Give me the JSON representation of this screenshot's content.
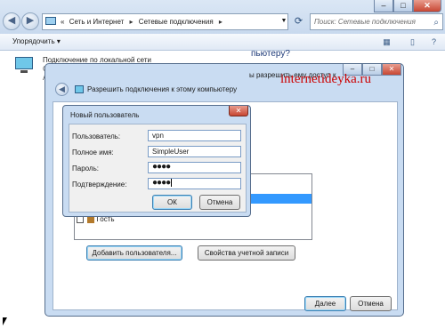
{
  "explorer": {
    "breadcrumb_lead": "«",
    "breadcrumbs": [
      "Сеть и Интернет",
      "Сетевые подключения"
    ],
    "separator": "▸",
    "search_placeholder": "Поиск: Сетевые подключения",
    "window_controls": {
      "minimize": "–",
      "maximize": "□",
      "close": "✕"
    }
  },
  "toolbar": {
    "organize": "Упорядочить ▾"
  },
  "connection": {
    "name": "Подключение по локальной сети",
    "frag1": "С",
    "frag2": "А"
  },
  "wizard": {
    "title": "Разрешить подключения к этому компьютеру",
    "heading": "пьютеру?",
    "description": "ы разрешить ему доступ к",
    "guest_label": "Гость",
    "add_user_button": "Добавить пользователя...",
    "account_props_button": "Свойства учетной записи",
    "next_button": "Далее",
    "cancel_button": "Отмена",
    "back_glyph": "◀",
    "window_controls": {
      "minimize": "–",
      "maximize": "□",
      "close": "✕"
    }
  },
  "watermark": "internetideyka.ru",
  "new_user_dialog": {
    "title": "Новый пользователь",
    "close_glyph": "✕",
    "fields": [
      {
        "label": "Пользователь:",
        "value": "vpn"
      },
      {
        "label": "Полное имя:",
        "value": "SimpleUser"
      },
      {
        "label": "Пароль:",
        "value": "●●●●"
      },
      {
        "label": "Подтверждение:",
        "value": "●●●●"
      }
    ],
    "ok_button": "ОК",
    "cancel_button": "Отмена"
  },
  "icons": [
    "back-arrow-icon",
    "forward-arrow-icon",
    "network-folder-icon",
    "refresh-icon",
    "search-icon",
    "view-options-icon",
    "preview-pane-icon",
    "help-icon",
    "network-adapter-icon",
    "guest-user-icon",
    "mouse-cursor-icon"
  ]
}
